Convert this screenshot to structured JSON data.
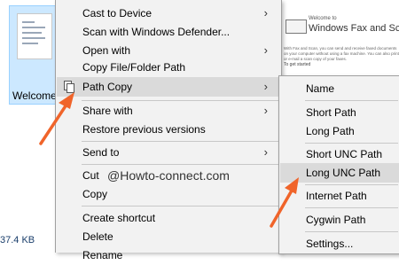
{
  "explorer": {
    "file_name": "Welcome to Fax and Scan",
    "file_size": "37.4 KB",
    "preview": {
      "welcome_small": "Welcome to",
      "title": "Windows Fax and Scan",
      "para": "With Fax and Scan, you can send and receive faxed documents on your computer without using a fax machine. You can also print or e-mail a scan copy of your faxes.",
      "heading": "To get started"
    }
  },
  "context_menu": {
    "items": [
      {
        "label": "Cast to Device"
      },
      {
        "label": "Scan with Windows Defender..."
      },
      {
        "label": "Open with"
      },
      {
        "label": "Copy File/Folder Path"
      },
      {
        "label": "Path Copy"
      },
      {
        "label": "Share with"
      },
      {
        "label": "Restore previous versions"
      },
      {
        "label": "Send to"
      },
      {
        "label": "Cut"
      },
      {
        "label": "Copy"
      },
      {
        "label": "Create shortcut"
      },
      {
        "label": "Delete"
      },
      {
        "label": "Rename"
      }
    ],
    "watermark": "@Howto-connect.com"
  },
  "submenu": {
    "items": [
      {
        "label": "Name"
      },
      {
        "label": "Short Path"
      },
      {
        "label": "Long Path"
      },
      {
        "label": "Short UNC Path"
      },
      {
        "label": "Long UNC Path"
      },
      {
        "label": "Internet Path"
      },
      {
        "label": "Cygwin Path"
      },
      {
        "label": "Settings..."
      }
    ]
  },
  "colors": {
    "highlight": "#dadada",
    "menu_bg": "#f2f2f2",
    "arrow": "#f0642a",
    "selection": "#cce8ff"
  }
}
